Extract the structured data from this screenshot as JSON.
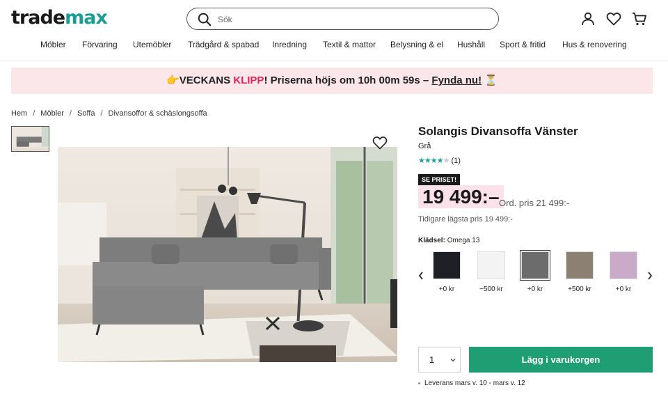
{
  "header": {
    "logo_main": "trade",
    "logo_accent": "max",
    "search_placeholder": "Sök"
  },
  "nav": [
    "Möbler",
    "Förvaring",
    "Utemöbler",
    "Trädgård & spabad",
    "Inredning",
    "Textil & mattor",
    "Belysning & el",
    "Hushåll",
    "Sport & fritid",
    "Hus & renovering"
  ],
  "promo": {
    "emoji": "👉",
    "text_a": "VECKANS ",
    "text_b": "KLIPP",
    "text_c": "! Priserna höjs om 10h 00m 59s – ",
    "cta": "Fynda nu!",
    "emoji_end": "⏳"
  },
  "breadcrumb": [
    "Hem",
    "Möbler",
    "Soffa",
    "Divansoffor & schäslongsoffa"
  ],
  "product": {
    "title": "Solangis Divansoffa Vänster",
    "color": "Grå",
    "rating": 4,
    "rating_max": 5,
    "review_count": "(1)",
    "badge": "SE PRISET!",
    "price": "19 499:–",
    "ord_price": "Ord. pris 21 499:-",
    "lowest_price": "Tidigare lägsta pris 19 499:-",
    "fabric_label": "Klädsel:",
    "fabric_value": "Omega 13",
    "swatches": [
      {
        "color": "#1f2026",
        "price": "+0 kr",
        "selected": false
      },
      {
        "color": "#f3f3f3",
        "price": "−500 kr",
        "selected": false
      },
      {
        "color": "#6c6c6c",
        "price": "+0 kr",
        "selected": true
      },
      {
        "color": "#8c8073",
        "price": "+500 kr",
        "selected": false
      },
      {
        "color": "#c9aac8",
        "price": "+0 kr",
        "selected": false
      }
    ],
    "quantity": "1",
    "add_to_cart": "Lägg i varukorgen",
    "delivery": "Leverans mars v. 10 - mars v. 12"
  },
  "colors": {
    "accent": "#1a9e94",
    "cart_button": "#1f9e73",
    "promo_bg": "#fbe6ea",
    "klipp": "#e0245e"
  }
}
